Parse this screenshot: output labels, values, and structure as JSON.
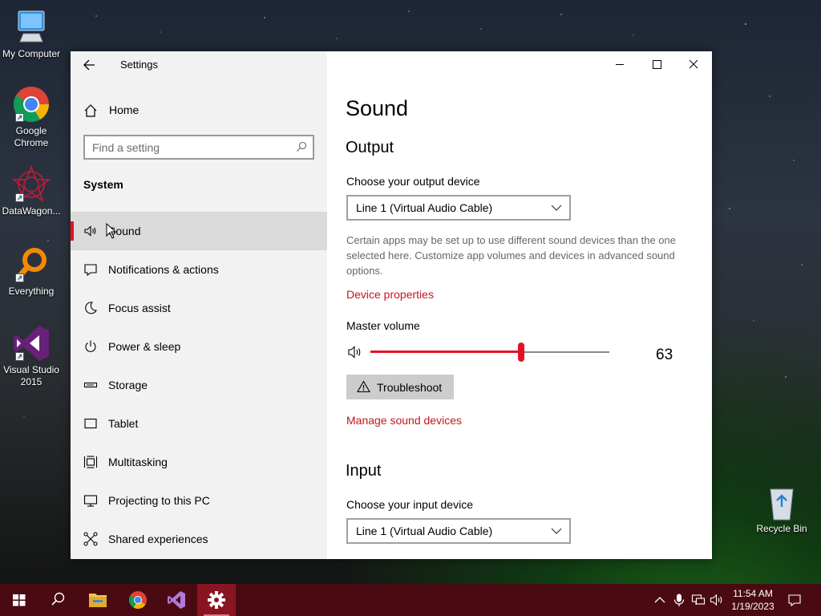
{
  "desktop": {
    "icons": [
      {
        "label": "My Computer",
        "icon": "computer-icon"
      },
      {
        "label": "Google Chrome",
        "icon": "chrome-icon"
      },
      {
        "label": "DataWagon...",
        "icon": "datawagon-icon"
      },
      {
        "label": "Everything",
        "icon": "everything-search-icon"
      },
      {
        "label": "Visual Studio 2015",
        "icon": "visual-studio-icon"
      },
      {
        "label": "Recycle Bin",
        "icon": "recycle-bin-icon"
      }
    ]
  },
  "window": {
    "title": "Settings",
    "caption_buttons": [
      "minimize",
      "maximize",
      "close"
    ]
  },
  "sidebar": {
    "home_label": "Home",
    "search_placeholder": "Find a setting",
    "section_label": "System",
    "items": [
      {
        "label": "Sound",
        "icon": "speaker-icon",
        "active": true
      },
      {
        "label": "Notifications & actions",
        "icon": "message-icon"
      },
      {
        "label": "Focus assist",
        "icon": "moon-icon"
      },
      {
        "label": "Power & sleep",
        "icon": "power-icon"
      },
      {
        "label": "Storage",
        "icon": "storage-icon"
      },
      {
        "label": "Tablet",
        "icon": "tablet-icon"
      },
      {
        "label": "Multitasking",
        "icon": "multitasking-icon"
      },
      {
        "label": "Projecting to this PC",
        "icon": "projecting-icon"
      },
      {
        "label": "Shared experiences",
        "icon": "shared-experiences-icon"
      }
    ]
  },
  "main": {
    "page_title": "Sound",
    "output": {
      "heading": "Output",
      "device_label": "Choose your output device",
      "device_value": "Line 1 (Virtual Audio Cable)",
      "description": "Certain apps may be set up to use different sound devices than the one selected here. Customize app volumes and devices in advanced sound options.",
      "device_properties_link": "Device properties",
      "master_volume_label": "Master volume",
      "volume_value": "63",
      "volume_level": 63,
      "troubleshoot_label": "Troubleshoot",
      "manage_devices_link": "Manage sound devices"
    },
    "input": {
      "heading": "Input",
      "device_label": "Choose your input device",
      "device_value": "Line 1 (Virtual Audio Cable)"
    }
  },
  "taskbar": {
    "apps": [
      "start-icon",
      "search-icon",
      "file-explorer-icon",
      "chrome-icon",
      "visual-studio-icon",
      "settings-gear-icon"
    ],
    "tray": [
      "chevron-up-icon",
      "microphone-icon",
      "network-icon",
      "volume-icon"
    ],
    "time": "11:54 AM",
    "date": "1/19/2023"
  },
  "colors": {
    "accent": "#e81123",
    "link": "#c4161c",
    "taskbar": "#4a0a12"
  }
}
